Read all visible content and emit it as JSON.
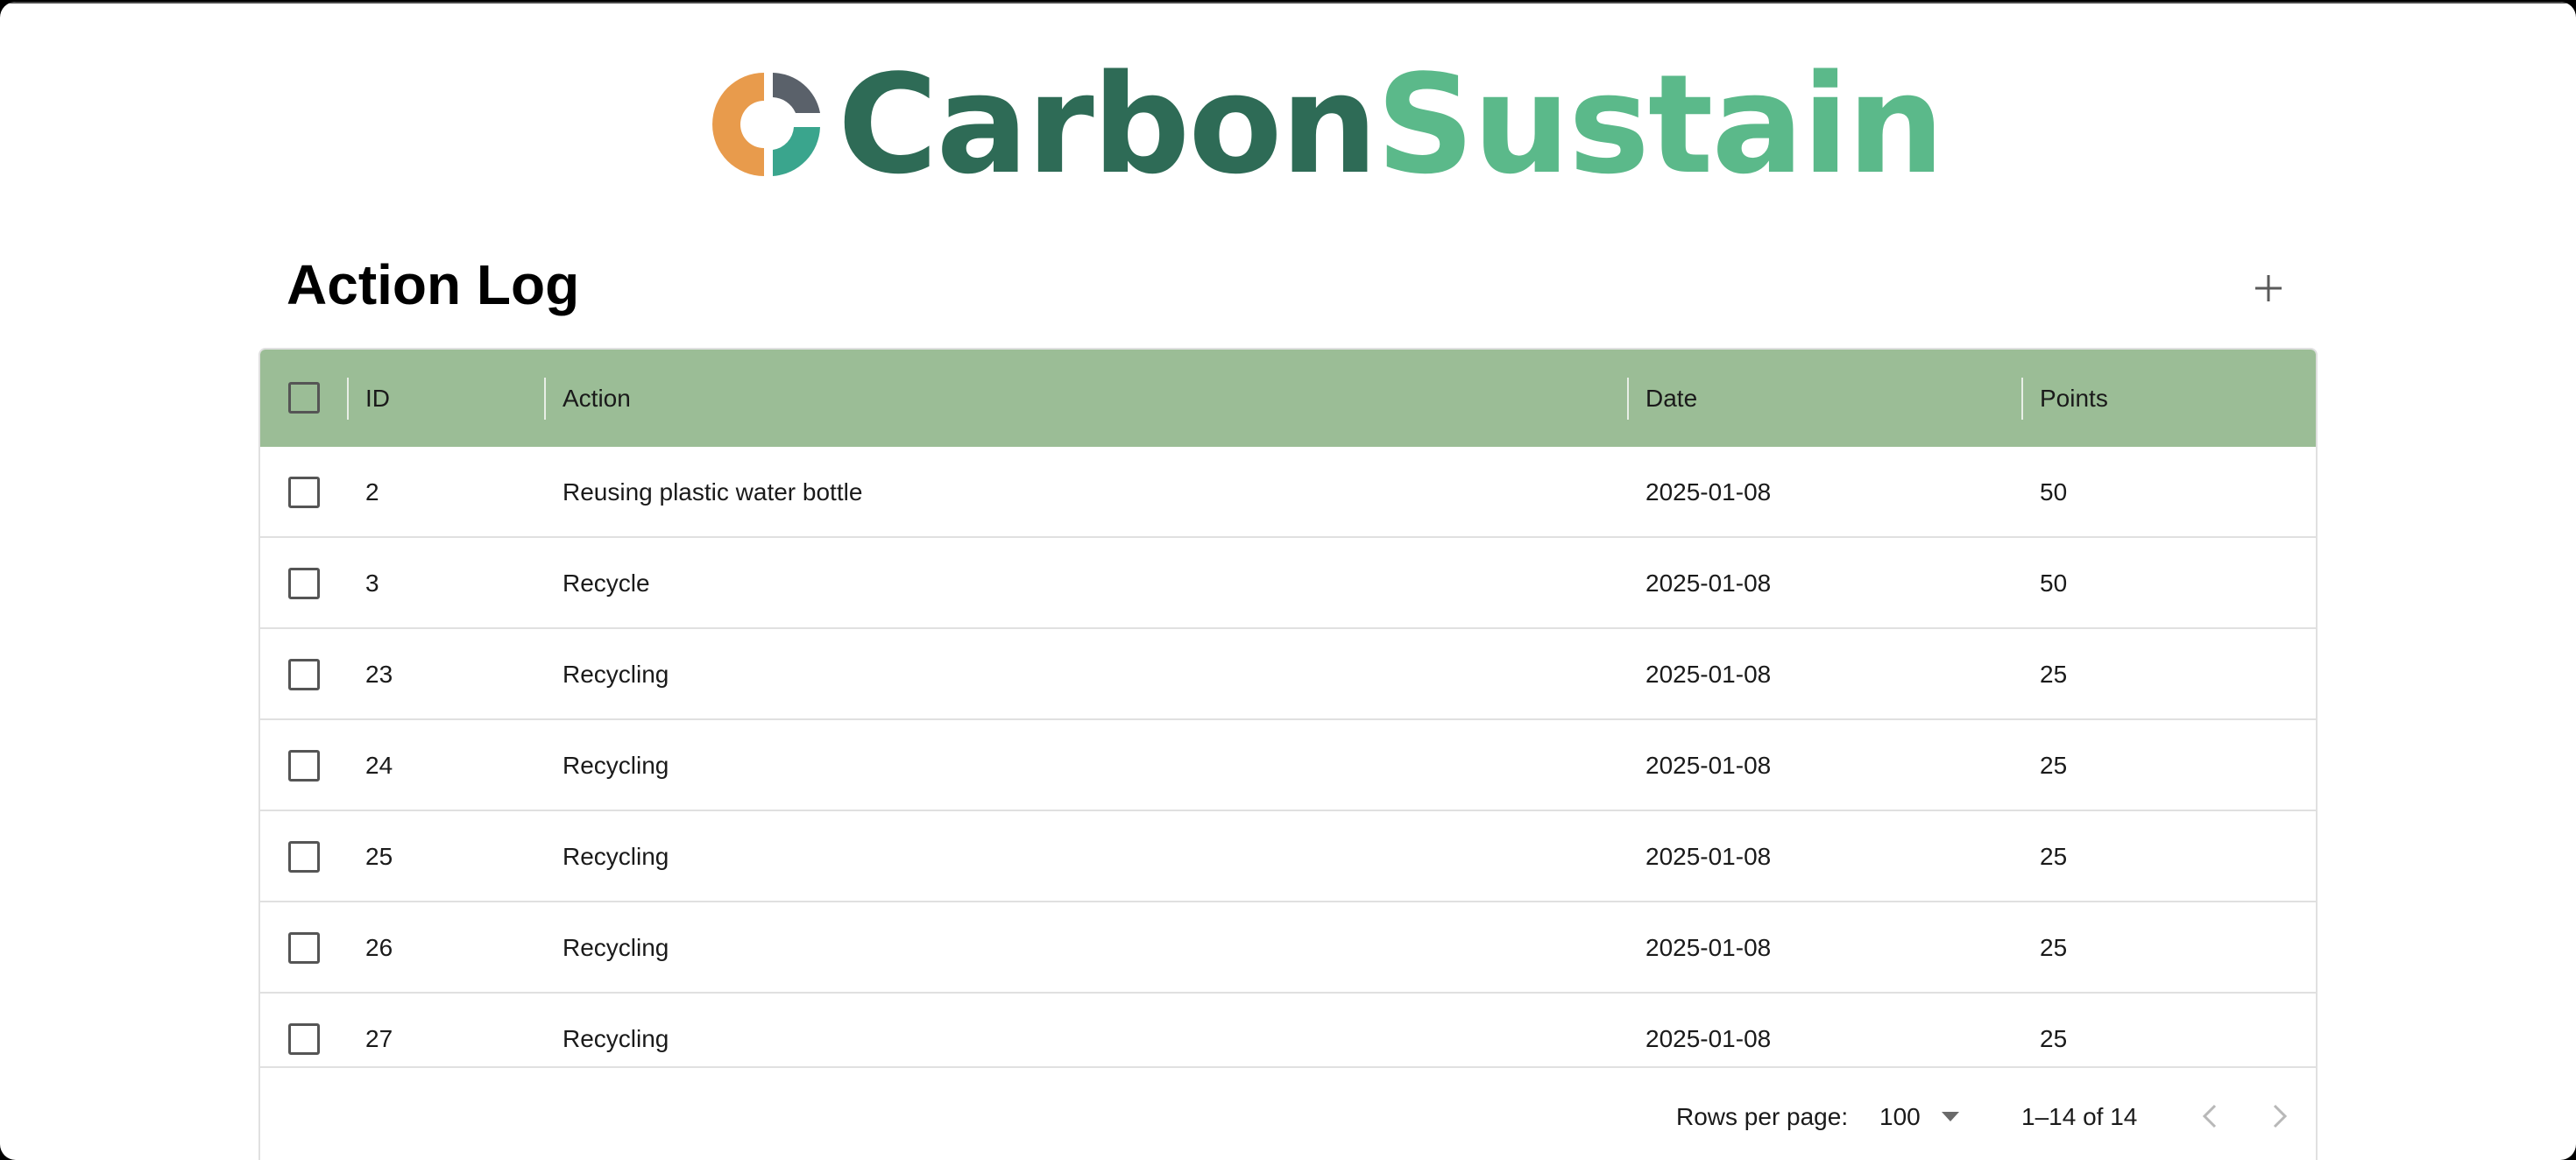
{
  "brand": {
    "name_part1": "Carbon",
    "name_part2": "Sustain",
    "colors": {
      "orange": "#e89b4c",
      "slate": "#5a616a",
      "teal": "#3aa58d",
      "dark_green": "#2e6b56",
      "light_green": "#5bb98a"
    }
  },
  "page": {
    "title": "Action Log",
    "add_icon": "plus-icon"
  },
  "table": {
    "header_color": "#9bbd96",
    "columns": [
      "ID",
      "Action",
      "Date",
      "Points"
    ],
    "rows": [
      {
        "id": "2",
        "action": "Reusing plastic water bottle",
        "date": "2025-01-08",
        "points": "50"
      },
      {
        "id": "3",
        "action": "Recycle",
        "date": "2025-01-08",
        "points": "50"
      },
      {
        "id": "23",
        "action": "Recycling",
        "date": "2025-01-08",
        "points": "25"
      },
      {
        "id": "24",
        "action": "Recycling",
        "date": "2025-01-08",
        "points": "25"
      },
      {
        "id": "25",
        "action": "Recycling",
        "date": "2025-01-08",
        "points": "25"
      },
      {
        "id": "26",
        "action": "Recycling",
        "date": "2025-01-08",
        "points": "25"
      },
      {
        "id": "27",
        "action": "Recycling",
        "date": "2025-01-08",
        "points": "25"
      }
    ]
  },
  "pagination": {
    "rows_per_page_label": "Rows per page:",
    "rows_per_page_value": "100",
    "range_text": "1–14 of 14",
    "prev_icon": "chevron-left-icon",
    "next_icon": "chevron-right-icon"
  }
}
